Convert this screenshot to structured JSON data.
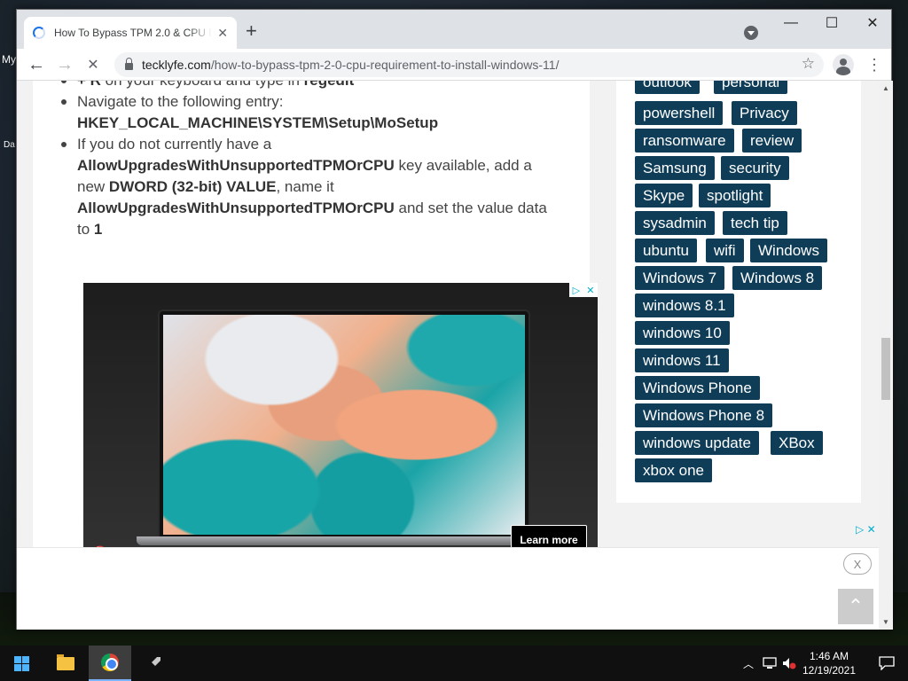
{
  "desktop": {
    "label_my": "My",
    "label_da": "Da"
  },
  "browser": {
    "tab_title": "How To Bypass TPM 2.0 & CPU R",
    "tab_close": "✕",
    "new_tab": "+",
    "url_domain": "tecklyfe.com",
    "url_path": "/how-to-bypass-tpm-2-0-cpu-requirement-to-install-windows-11/",
    "back": "←",
    "forward": "→",
    "stop": "✕",
    "star": "☆",
    "menu": "⋮",
    "minimize": "—",
    "maximize": "☐",
    "close": "✕"
  },
  "article": {
    "step0_lead": "+ R",
    "step0_text": " on your keyboard and type in ",
    "step0_bold": "regedit",
    "step1_text": "Navigate to the following entry:",
    "step1_bold": "HKEY_LOCAL_MACHINE\\SYSTEM\\Setup\\MoSetup",
    "step2_a": "If you do not currently have a",
    "step2_bold1": "AllowUpgradesWithUnsupportedTPMOrCPU",
    "step2_b": " key available, add a new ",
    "step2_bold2": "DWORD (32-bit) VALUE",
    "step2_c": ", name it",
    "step2_bold3": "AllowUpgradesWithUnsupportedTPMOrCPU",
    "step2_d": " and set the value data to ",
    "step2_bold4": "1"
  },
  "ad": {
    "learn_more": "Learn more",
    "choices_play": "▷",
    "choices_close": "✕",
    "mute": "🔇"
  },
  "sidebar": {
    "tags": [
      {
        "label": "outlook"
      },
      {
        "label": "personal"
      },
      {
        "label": "powershell"
      },
      {
        "label": "Privacy"
      },
      {
        "label": "ransomware"
      },
      {
        "label": "review"
      },
      {
        "label": "Samsung"
      },
      {
        "label": "security"
      },
      {
        "label": "Skype"
      },
      {
        "label": "spotlight"
      },
      {
        "label": "sysadmin"
      },
      {
        "label": "tech tip"
      },
      {
        "label": "ubuntu"
      },
      {
        "label": "wifi"
      },
      {
        "label": "Windows"
      },
      {
        "label": "Windows 7"
      },
      {
        "label": "Windows 8"
      },
      {
        "label": "windows 8.1"
      },
      {
        "label": "windows 10"
      },
      {
        "label": "windows 11"
      },
      {
        "label": "Windows Phone"
      },
      {
        "label": "Windows Phone 8"
      },
      {
        "label": "windows update"
      },
      {
        "label": "XBox"
      },
      {
        "label": "xbox one"
      }
    ]
  },
  "bottom_ad": {
    "close": "X",
    "to_top": "⌃",
    "choices": "▷ ✕"
  },
  "taskbar": {
    "time": "1:46 AM",
    "date": "12/19/2021",
    "tray_chevron": "︿"
  },
  "colors": {
    "tag_bg": "#0f3d58",
    "accent": "#1a73e8"
  }
}
